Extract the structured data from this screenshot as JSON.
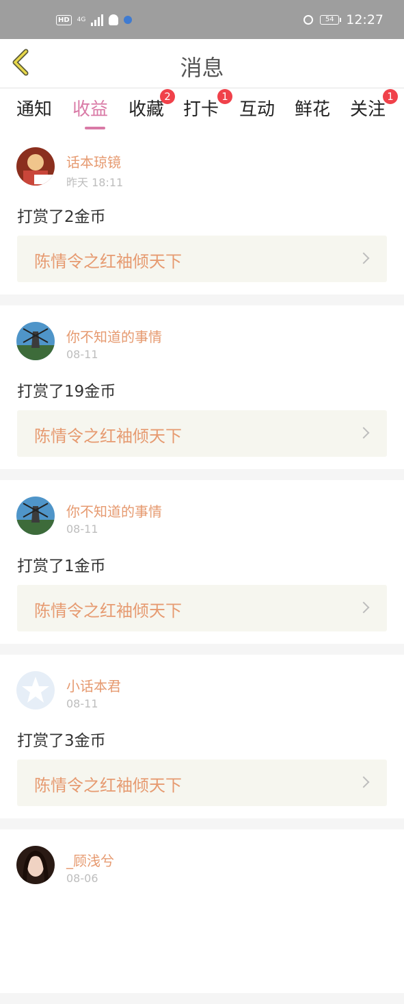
{
  "status_bar": {
    "hd": "HD",
    "network": "4G",
    "battery": "54",
    "time": "12:27",
    "icons": [
      "hd-icon",
      "signal-icon",
      "qq-icon",
      "app-icon",
      "alarm-icon",
      "battery-icon"
    ]
  },
  "nav": {
    "title": "消息",
    "back_icon": "chevron-left-icon"
  },
  "tabs": [
    {
      "label": "通知",
      "badge": ""
    },
    {
      "label": "收益",
      "badge": "",
      "active": true
    },
    {
      "label": "收藏",
      "badge": "2"
    },
    {
      "label": "打卡",
      "badge": "1"
    },
    {
      "label": "互动",
      "badge": ""
    },
    {
      "label": "鲜花",
      "badge": ""
    },
    {
      "label": "关注",
      "badge": "1"
    }
  ],
  "items": [
    {
      "user": "话本琼镜",
      "time": "昨天 18:11",
      "text": "打赏了2金币",
      "book": "陈情令之红袖倾天下"
    },
    {
      "user": "你不知道的事情",
      "time": "08-11",
      "text": "打赏了19金币",
      "book": "陈情令之红袖倾天下"
    },
    {
      "user": "你不知道的事情",
      "time": "08-11",
      "text": "打赏了1金币",
      "book": "陈情令之红袖倾天下"
    },
    {
      "user": "小话本君",
      "time": "08-11",
      "text": "打赏了3金币",
      "book": "陈情令之红袖倾天下"
    },
    {
      "user": "_顾浅兮",
      "time": "08-06",
      "text": "",
      "book": ""
    }
  ],
  "colors": {
    "accent": "#d97aa6",
    "name": "#e69a70",
    "badge": "#f0414a",
    "status_bar": "#9e9e9e"
  }
}
